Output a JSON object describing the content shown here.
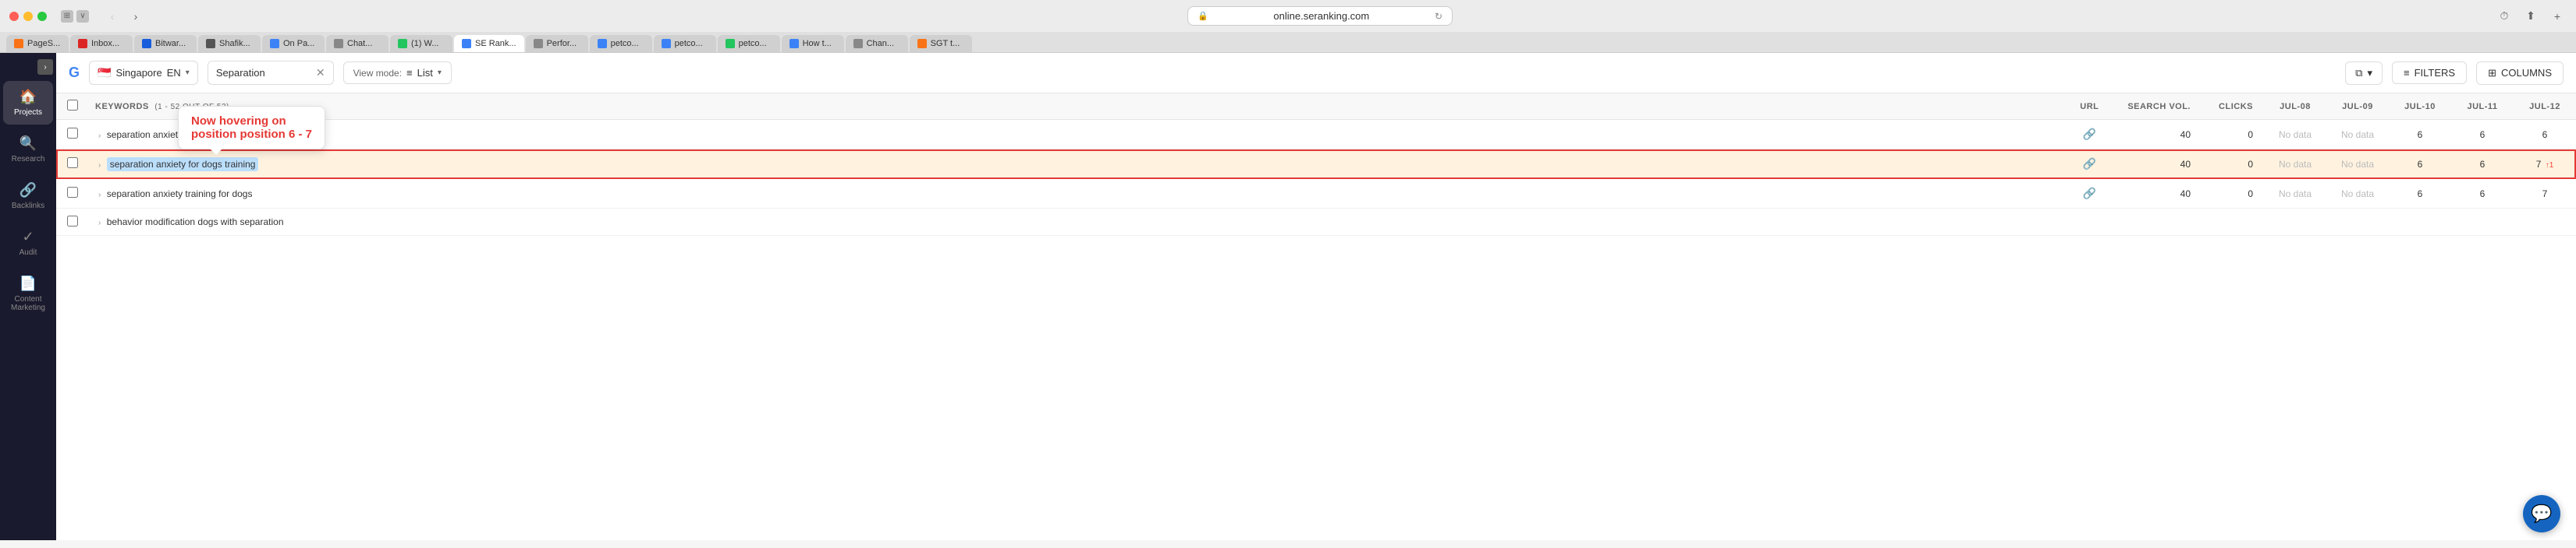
{
  "browser": {
    "url": "online.seranking.com",
    "tabs": [
      {
        "id": "pagespy",
        "label": "PageS...",
        "favicon_color": "#f97316",
        "active": false
      },
      {
        "id": "inbox",
        "label": "Inbox...",
        "favicon_color": "#dc2626",
        "active": false
      },
      {
        "id": "bitwarden",
        "label": "Bitwar...",
        "favicon_color": "#175ddc",
        "active": false
      },
      {
        "id": "shafik",
        "label": "Shafik...",
        "favicon_color": "#333",
        "active": false
      },
      {
        "id": "onpage",
        "label": "On Pa...",
        "favicon_color": "#3b82f6",
        "active": false
      },
      {
        "id": "chat",
        "label": "Chat...",
        "favicon_color": "#888",
        "active": false
      },
      {
        "id": "w",
        "label": "(1) W...",
        "favicon_color": "#22c55e",
        "active": false
      },
      {
        "id": "seranking",
        "label": "SE Rank...",
        "favicon_color": "#3b82f6",
        "active": true
      },
      {
        "id": "perfor",
        "label": "Perfor...",
        "favicon_color": "#888",
        "active": false
      },
      {
        "id": "petco1",
        "label": "petco...",
        "favicon_color": "#3b82f6",
        "active": false
      },
      {
        "id": "petco2",
        "label": "petco...",
        "favicon_color": "#3b82f6",
        "active": false
      },
      {
        "id": "petco3",
        "label": "petco...",
        "favicon_color": "#22c55e",
        "active": false
      },
      {
        "id": "howt",
        "label": "How t...",
        "favicon_color": "#3b82f6",
        "active": false
      },
      {
        "id": "chan",
        "label": "Chan...",
        "favicon_color": "#888",
        "active": false
      },
      {
        "id": "sgt",
        "label": "SGT t...",
        "favicon_color": "#f97316",
        "active": false
      }
    ]
  },
  "toolbar": {
    "country": "Singapore",
    "country_flag": "🇸🇬",
    "language": "EN",
    "keyword": "Separation",
    "view_mode": "List",
    "filters_label": "FILTERS",
    "columns_label": "COLUMNS"
  },
  "sidebar": {
    "items": [
      {
        "id": "projects",
        "label": "Projects",
        "icon": "🏠",
        "active": true
      },
      {
        "id": "research",
        "label": "Research",
        "icon": "🔍",
        "active": false
      },
      {
        "id": "backlinks",
        "label": "Backlinks",
        "icon": "🔗",
        "active": false
      },
      {
        "id": "audit",
        "label": "Audit",
        "icon": "✓",
        "active": false
      },
      {
        "id": "content",
        "label": "Content Marketing",
        "icon": "📄",
        "active": false
      }
    ]
  },
  "table": {
    "header": {
      "keywords_label": "KEYWORDS",
      "keywords_count": "(1 - 52 OUT OF 52)",
      "url_label": "URL",
      "searchvol_label": "SEARCH VOL.",
      "clicks_label": "CLICKS",
      "date1": "JUL-08",
      "date2": "JUL-09",
      "date3": "JUL-10",
      "date4": "JUL-11",
      "date5": "JUL-12"
    },
    "rows": [
      {
        "id": "row1",
        "keyword": "separation anxiety dogs training",
        "keyword_selected": false,
        "has_link": true,
        "search_vol": "40",
        "clicks": "0",
        "jul08": "No data",
        "jul09": "No data",
        "jul10": "6",
        "jul11": "6",
        "jul12": "6",
        "jul12_change": null,
        "highlighted": false
      },
      {
        "id": "row2",
        "keyword": "separation anxiety for dogs training",
        "keyword_selected": true,
        "has_link": true,
        "search_vol": "40",
        "clicks": "0",
        "jul08": "No data",
        "jul09": "No data",
        "jul10": "6",
        "jul11": "6",
        "jul12": "7",
        "jul12_change": "↑1",
        "jul12_change_dir": "up",
        "highlighted": true
      },
      {
        "id": "row3",
        "keyword": "separation anxiety training for dogs",
        "keyword_selected": false,
        "has_link": true,
        "search_vol": "40",
        "clicks": "0",
        "jul08": "No data",
        "jul09": "No data",
        "jul10": "6",
        "jul11": "6",
        "jul12": "7",
        "jul12_change": null,
        "highlighted": false
      },
      {
        "id": "row4",
        "keyword": "behavior modification dogs with separation",
        "keyword_selected": false,
        "has_link": false,
        "search_vol": "",
        "clicks": "",
        "jul08": "",
        "jul09": "",
        "jul10": "",
        "jul11": "",
        "jul12": "",
        "jul12_change": null,
        "highlighted": false,
        "partial": true
      }
    ],
    "hover_tooltip": {
      "line1": "Now hovering on",
      "line2": "position position 6 - 7"
    }
  },
  "chat_button": {
    "icon": "💬"
  }
}
